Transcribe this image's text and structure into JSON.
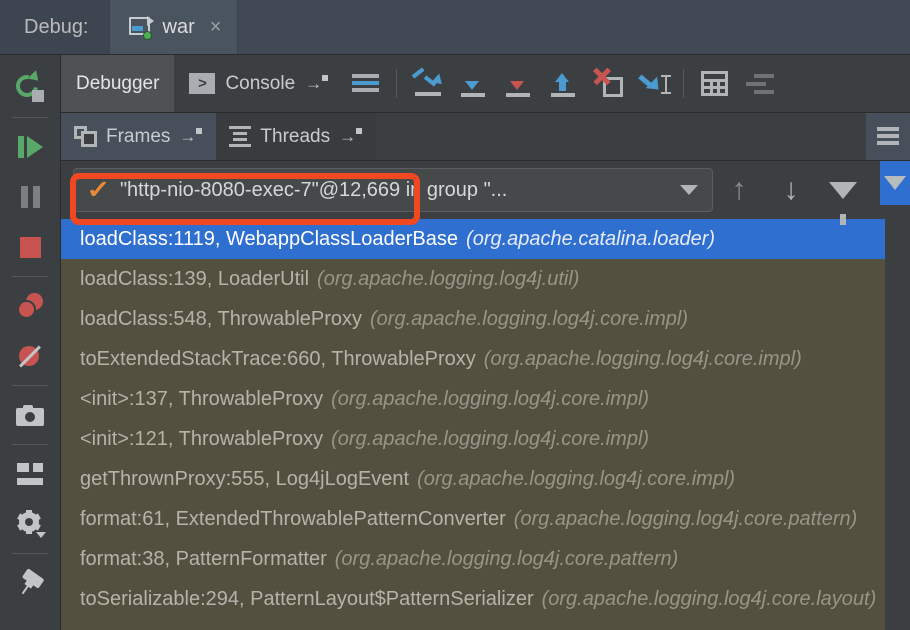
{
  "window": {
    "debug_label": "Debug:",
    "tab_title": "war",
    "tab_close": "×",
    "tab_icon": "war-deploy-icon"
  },
  "left_rail": {
    "buttons": [
      {
        "name": "rerun-button",
        "tooltip": "Rerun"
      },
      {
        "name": "resume-program-button",
        "tooltip": "Resume Program"
      },
      {
        "name": "pause-program-button",
        "tooltip": "Pause Program"
      },
      {
        "name": "stop-button",
        "tooltip": "Stop"
      },
      {
        "name": "view-breakpoints-button",
        "tooltip": "View Breakpoints"
      },
      {
        "name": "mute-breakpoints-button",
        "tooltip": "Mute Breakpoints"
      },
      {
        "name": "snapshot-button",
        "tooltip": "Get Thread Dump"
      },
      {
        "name": "restore-layout-button",
        "tooltip": "Restore Layout"
      },
      {
        "name": "settings-button",
        "tooltip": "Settings"
      },
      {
        "name": "pin-tab-button",
        "tooltip": "Pin Tab"
      }
    ]
  },
  "debugger_toolbar": {
    "tabs": [
      {
        "label": "Debugger",
        "selected": true
      },
      {
        "label": "Console",
        "selected": false
      }
    ],
    "pin_arrow": "→",
    "actions": [
      {
        "name": "show-execution-point-icon",
        "label": "Show Execution Point"
      },
      {
        "name": "step-over-icon",
        "label": "Step Over"
      },
      {
        "name": "step-into-icon",
        "label": "Step Into"
      },
      {
        "name": "force-step-into-icon",
        "label": "Force Step Into"
      },
      {
        "name": "step-out-icon",
        "label": "Step Out"
      },
      {
        "name": "drop-frame-icon",
        "label": "Drop Frame"
      },
      {
        "name": "run-to-cursor-icon",
        "label": "Run to Cursor"
      },
      {
        "name": "evaluate-expression-icon",
        "label": "Evaluate Expression"
      },
      {
        "name": "debugger-settings-icon",
        "label": "Settings"
      }
    ]
  },
  "frames_panel": {
    "tabs": [
      {
        "label": "Frames",
        "selected": true
      },
      {
        "label": "Threads",
        "selected": false
      }
    ],
    "pin_arrow": "→",
    "menu_icon": "hamburger-menu-icon",
    "thread_selector": {
      "status_icon": "✓",
      "value": "\"http-nio-8080-exec-7\"@12,669 in group \"...",
      "caret": "chevron-down-icon"
    },
    "selector_actions": [
      {
        "name": "frame-up-button",
        "glyph": "↑"
      },
      {
        "name": "frame-down-button",
        "glyph": "↓"
      },
      {
        "name": "filter-frames-button",
        "glyph": "funnel-icon"
      }
    ],
    "dropdown_button": {
      "name": "expand-dropdown-button",
      "glyph": "▼"
    },
    "stack_frames": [
      {
        "method": "loadClass:1119, WebappClassLoaderBase",
        "package": "(org.apache.catalina.loader)",
        "selected": true
      },
      {
        "method": "loadClass:139, LoaderUtil",
        "package": "(org.apache.logging.log4j.util)",
        "selected": false
      },
      {
        "method": "loadClass:548, ThrowableProxy",
        "package": "(org.apache.logging.log4j.core.impl)",
        "selected": false
      },
      {
        "method": "toExtendedStackTrace:660, ThrowableProxy",
        "package": "(org.apache.logging.log4j.core.impl)",
        "selected": false
      },
      {
        "method": "<init>:137, ThrowableProxy",
        "package": "(org.apache.logging.log4j.core.impl)",
        "selected": false
      },
      {
        "method": "<init>:121, ThrowableProxy",
        "package": "(org.apache.logging.log4j.core.impl)",
        "selected": false
      },
      {
        "method": "getThrownProxy:555, Log4jLogEvent",
        "package": "(org.apache.logging.log4j.core.impl)",
        "selected": false
      },
      {
        "method": "format:61, ExtendedThrowablePatternConverter",
        "package": "(org.apache.logging.log4j.core.pattern)",
        "selected": false
      },
      {
        "method": "format:38, PatternFormatter",
        "package": "(org.apache.logging.log4j.core.pattern)",
        "selected": false
      },
      {
        "method": "toSerializable:294, PatternLayout$PatternSerializer",
        "package": "(org.apache.logging.log4j.core.layout)",
        "selected": false
      }
    ]
  },
  "annotation": {
    "name": "highlight-rectangle",
    "color": "#f24822"
  },
  "colors": {
    "window_bar": "#414a54",
    "panel_bg": "#3c3f41",
    "frames_bg": "#54503f",
    "selection_blue": "#2f6fd0",
    "accent_orange": "#e8893a",
    "green": "#59a869",
    "red": "#c75450",
    "blue_icon": "#4b9bd0"
  }
}
